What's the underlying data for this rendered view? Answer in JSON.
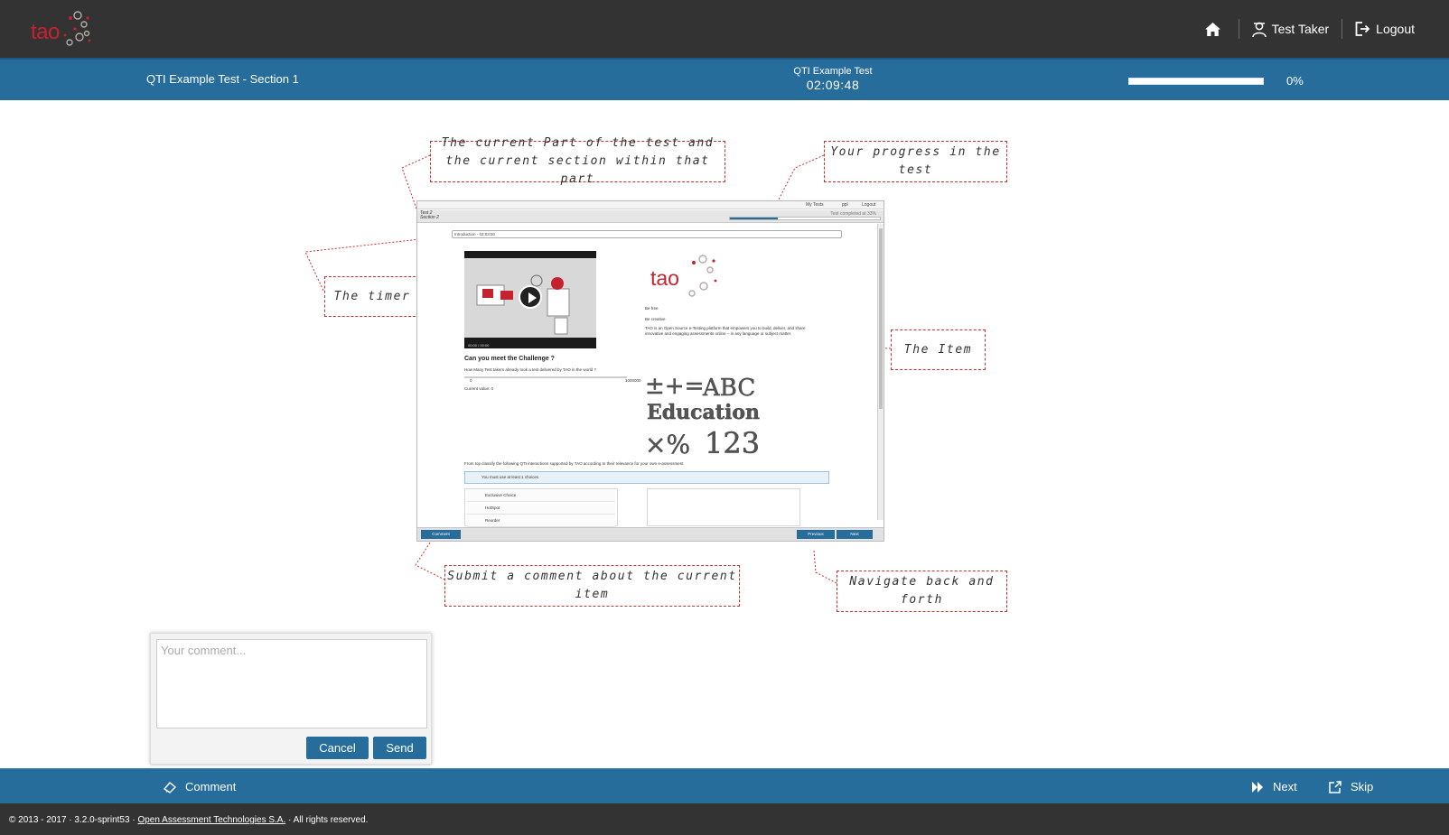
{
  "header": {
    "logo_text": "tao",
    "nav": {
      "home_icon": "home-icon",
      "test_taker_label": "Test Taker",
      "logout_label": "Logout"
    }
  },
  "test_bar": {
    "section_title": "QTI Example Test - Section 1",
    "test_name": "QTI Example Test",
    "timer": "02:09:48",
    "progress_fraction": 0,
    "progress_label": "0%"
  },
  "tutorial": {
    "callouts": {
      "part_section": [
        "The current Part of the test and",
        "the current section within that part"
      ],
      "progress": "Your progress in the test",
      "timer": "The timer",
      "item": "The Item",
      "comment": "Submit a comment about the current item",
      "navigate": "Navigate back and forth"
    },
    "mock": {
      "my_tests": "My Tests",
      "user": "ppl",
      "logout": "Logout",
      "test_label": "Test 2",
      "section_label": "Section 2",
      "completed": "Test completed at 33%",
      "timer_label": "Introduction - 02:03:50",
      "video_time": "00:00 / 00:00",
      "logo": "tao",
      "be_free": "Be free",
      "be_creative": "Be creative",
      "blurb": "TAO is an Open Source e-Testing platform that empowers you to build, deliver, and share innovative and engaging assessments online – in any language or subject matter.",
      "question": "Can you meet the Challenge ?",
      "slider_prompt": "How Many Test takers already took a test delivered by TAO in the world ?",
      "slider_min": "0",
      "slider_max": "1000000",
      "current_value": "Current value: 0",
      "order_prompt": "From top classify the following QTI interactions supported by TAO according to their relevance for your own e-assessment",
      "notice": "You must use at least 1 choices",
      "choices": [
        "Exclusive Choice",
        "HotSpot",
        "Reorder"
      ],
      "comment_button": "Comment",
      "previous_button": "Previous",
      "next_button": "Next",
      "edu_line1": "ABC",
      "edu_line2": "Education",
      "edu_line3": "123"
    }
  },
  "comment_popup": {
    "placeholder": "Your comment...",
    "value": "",
    "cancel_label": "Cancel",
    "send_label": "Send"
  },
  "action_bar": {
    "comment_label": "Comment",
    "next_label": "Next",
    "skip_label": "Skip"
  },
  "footer": {
    "prefix": "© 2013 - 2017 · 3.2.0-sprint53 ·",
    "company": "Open Assessment Technologies S.A.",
    "suffix": "· All rights reserved."
  },
  "colors": {
    "header_bg": "#333333",
    "accent_blue": "#266d9c",
    "brand_red": "#c4222e",
    "callout_border": "#c72e2e"
  }
}
